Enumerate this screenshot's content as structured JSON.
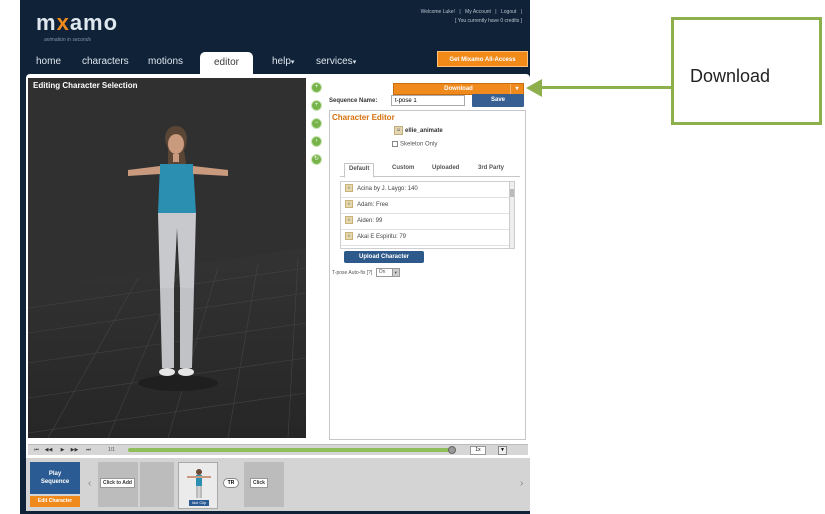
{
  "header": {
    "logo_prefix": "m",
    "logo_x": "x",
    "logo_suffix": "amo",
    "tagline": "animation in seconds",
    "welcome": "Welcome Luke!",
    "my_account": "My Account",
    "logout": "Logout",
    "credits": "[ You currently have 0 credits ]",
    "separator": "|"
  },
  "nav": {
    "items": [
      {
        "label": "home"
      },
      {
        "label": "characters"
      },
      {
        "label": "motions"
      },
      {
        "label": "editor"
      },
      {
        "label": "help"
      },
      {
        "label": "services"
      }
    ],
    "caret": "▾",
    "promo": "Get Mixamo All-Access"
  },
  "viewport": {
    "title": "Editing Character Selection",
    "controls": [
      "zoom-in",
      "add",
      "minus",
      "forward",
      "rotate"
    ]
  },
  "panel": {
    "download_label": "Download",
    "download_caret": "▾",
    "sequence_label": "Sequence Name:",
    "sequence_value": "t-pose 1",
    "save_label": "Save",
    "editor_title": "Character Editor",
    "character_name": "ellie_animate",
    "skeleton_label": "Skeleton Only",
    "tabs": [
      {
        "label": "Default"
      },
      {
        "label": "Custom"
      },
      {
        "label": "Uploaded"
      },
      {
        "label": "3rd Party"
      }
    ],
    "characters": [
      {
        "name": "Acina by J. Laygo: 140"
      },
      {
        "name": "Adam: Free"
      },
      {
        "name": "Aiden: 99"
      },
      {
        "name": "Akai E Espiritu: 79"
      }
    ],
    "upload_label": "Upload Character",
    "tpose_label": "T-pose Auto-fix [?]",
    "tpose_value": "On"
  },
  "timeline": {
    "frame": "1/1",
    "speed": "1x"
  },
  "sequence": {
    "play_label_1": "Play",
    "play_label_2": "Sequence",
    "edit_char_label": "Edit Character",
    "slot_add": "Click to Add",
    "char_thumb_label": "Idol Clip",
    "transition": "TR",
    "slot_click": "Click"
  },
  "callout": {
    "text": "Download"
  },
  "colors": {
    "accent_orange": "#f08a1c",
    "brand_blue": "#2b5b93",
    "dark_bg": "#0f2237",
    "callout_green": "#8db04c"
  }
}
